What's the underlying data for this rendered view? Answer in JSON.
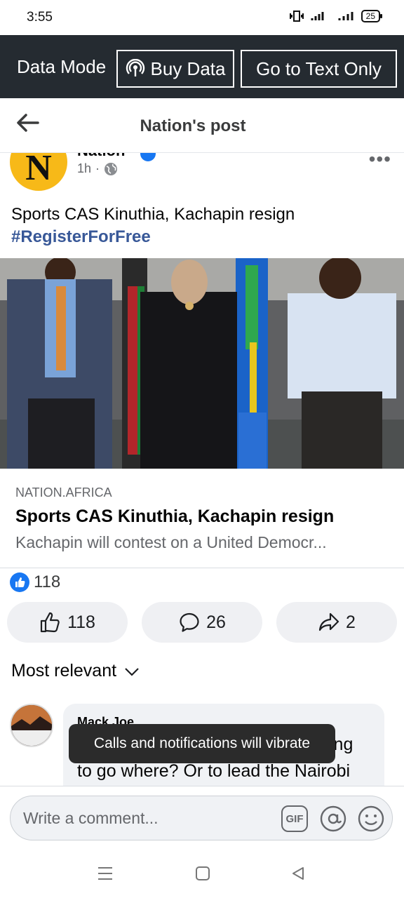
{
  "status_bar": {
    "time": "3:55",
    "battery": "25"
  },
  "data_bar": {
    "mode_label": "Data Mode",
    "buy_data": "Buy Data",
    "text_only": "Go to Text Only"
  },
  "header": {
    "title": "Nation's post"
  },
  "post": {
    "author_initial": "N",
    "author_name": "Nation",
    "time": "1h",
    "separator": "·",
    "text": "Sports CAS Kinuthia, Kachapin resign",
    "hashtag": "#RegisterForFree",
    "link": {
      "domain": "NATION.AFRICA",
      "title": "Sports CAS Kinuthia, Kachapin resign",
      "description": "Kachapin will contest on a United Democr..."
    },
    "reaction_count": "118",
    "actions": {
      "like": "118",
      "comment": "26",
      "share": "2"
    }
  },
  "sort": {
    "label": "Most relevant"
  },
  "comment": {
    "author": "Mack Joe",
    "line1": "ing",
    "line2": "to go where? Or to lead the Nairobi"
  },
  "toast": {
    "text": "Calls and notifications will vibrate"
  },
  "composer": {
    "placeholder": "Write a comment...",
    "gif": "GIF"
  },
  "colors": {
    "accent": "#1877f2",
    "hashtag": "#385898",
    "databar": "#252b31",
    "avatar": "#f7b918"
  }
}
